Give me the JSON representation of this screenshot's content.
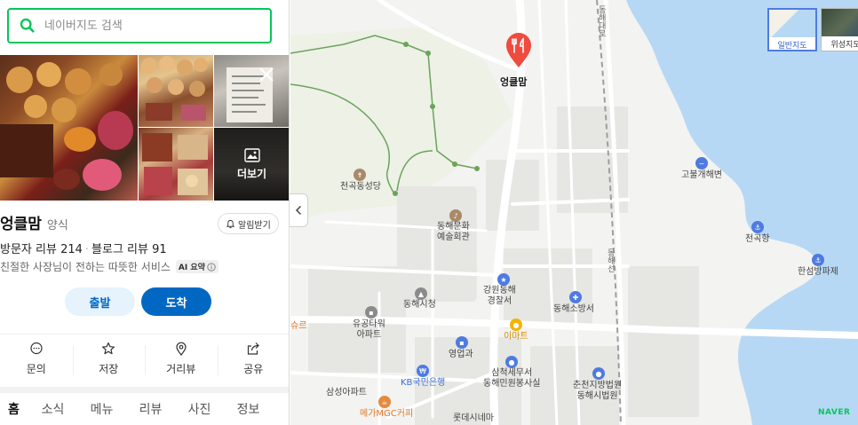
{
  "search": {
    "placeholder": "네이버지도 검색"
  },
  "photos": {
    "more_label": "더보기"
  },
  "place": {
    "name": "엉클맘",
    "category": "양식",
    "alarm_label": "알림받기",
    "visitor_reviews": "방문자 리뷰 214",
    "blog_reviews": "블로그 리뷰 91",
    "description": "친절한 사장님이 전하는 따뜻한 서비스",
    "ai_badge": "AI 요약"
  },
  "route": {
    "depart_label": "출발",
    "arrive_label": "도착"
  },
  "actions": [
    {
      "label": "문의",
      "icon": "chat-icon"
    },
    {
      "label": "저장",
      "icon": "star-icon"
    },
    {
      "label": "거리뷰",
      "icon": "pin-icon"
    },
    {
      "label": "공유",
      "icon": "share-icon"
    }
  ],
  "tabs": [
    "홈",
    "소식",
    "메뉴",
    "리뷰",
    "사진",
    "정보"
  ],
  "active_tab": "홈",
  "map": {
    "marker_label": "엉클맘",
    "map_type_normal": "일반지도",
    "map_type_satellite": "위성지도",
    "logo": "NAVER",
    "labels": {
      "cheongok_temple": "천곡동성당",
      "donghae_culture": "동해문화\n예술회관",
      "donghae_city_hall": "동해시청",
      "gangwon_police": "강원동해\n경찰서",
      "donghae_fire": "동해소방서",
      "yugong_tower": "유공타워\n아파트",
      "emart": "이마트",
      "business_office": "영업과",
      "kb_bank": "KB국민은행",
      "tax_office": "삼척세무서\n동해민원봉사실",
      "court": "춘천지방법원\n동해시법원",
      "samsung_apt": "삼성아파트",
      "megamgc": "메가MGC커피",
      "lotte_cinema": "롯데시네마",
      "goburang": "고불개해변",
      "cheongok_port": "천곡항",
      "hanseop_wave": "한섬방파제",
      "donghae_line": "동해선",
      "donghae_road": "동해대로",
      "shure": "슈르"
    }
  },
  "colors": {
    "naver_green": "#03c75a",
    "primary_blue": "#0068c3",
    "sea": "#b7d8f4",
    "marker_red": "#ef4b3f"
  }
}
